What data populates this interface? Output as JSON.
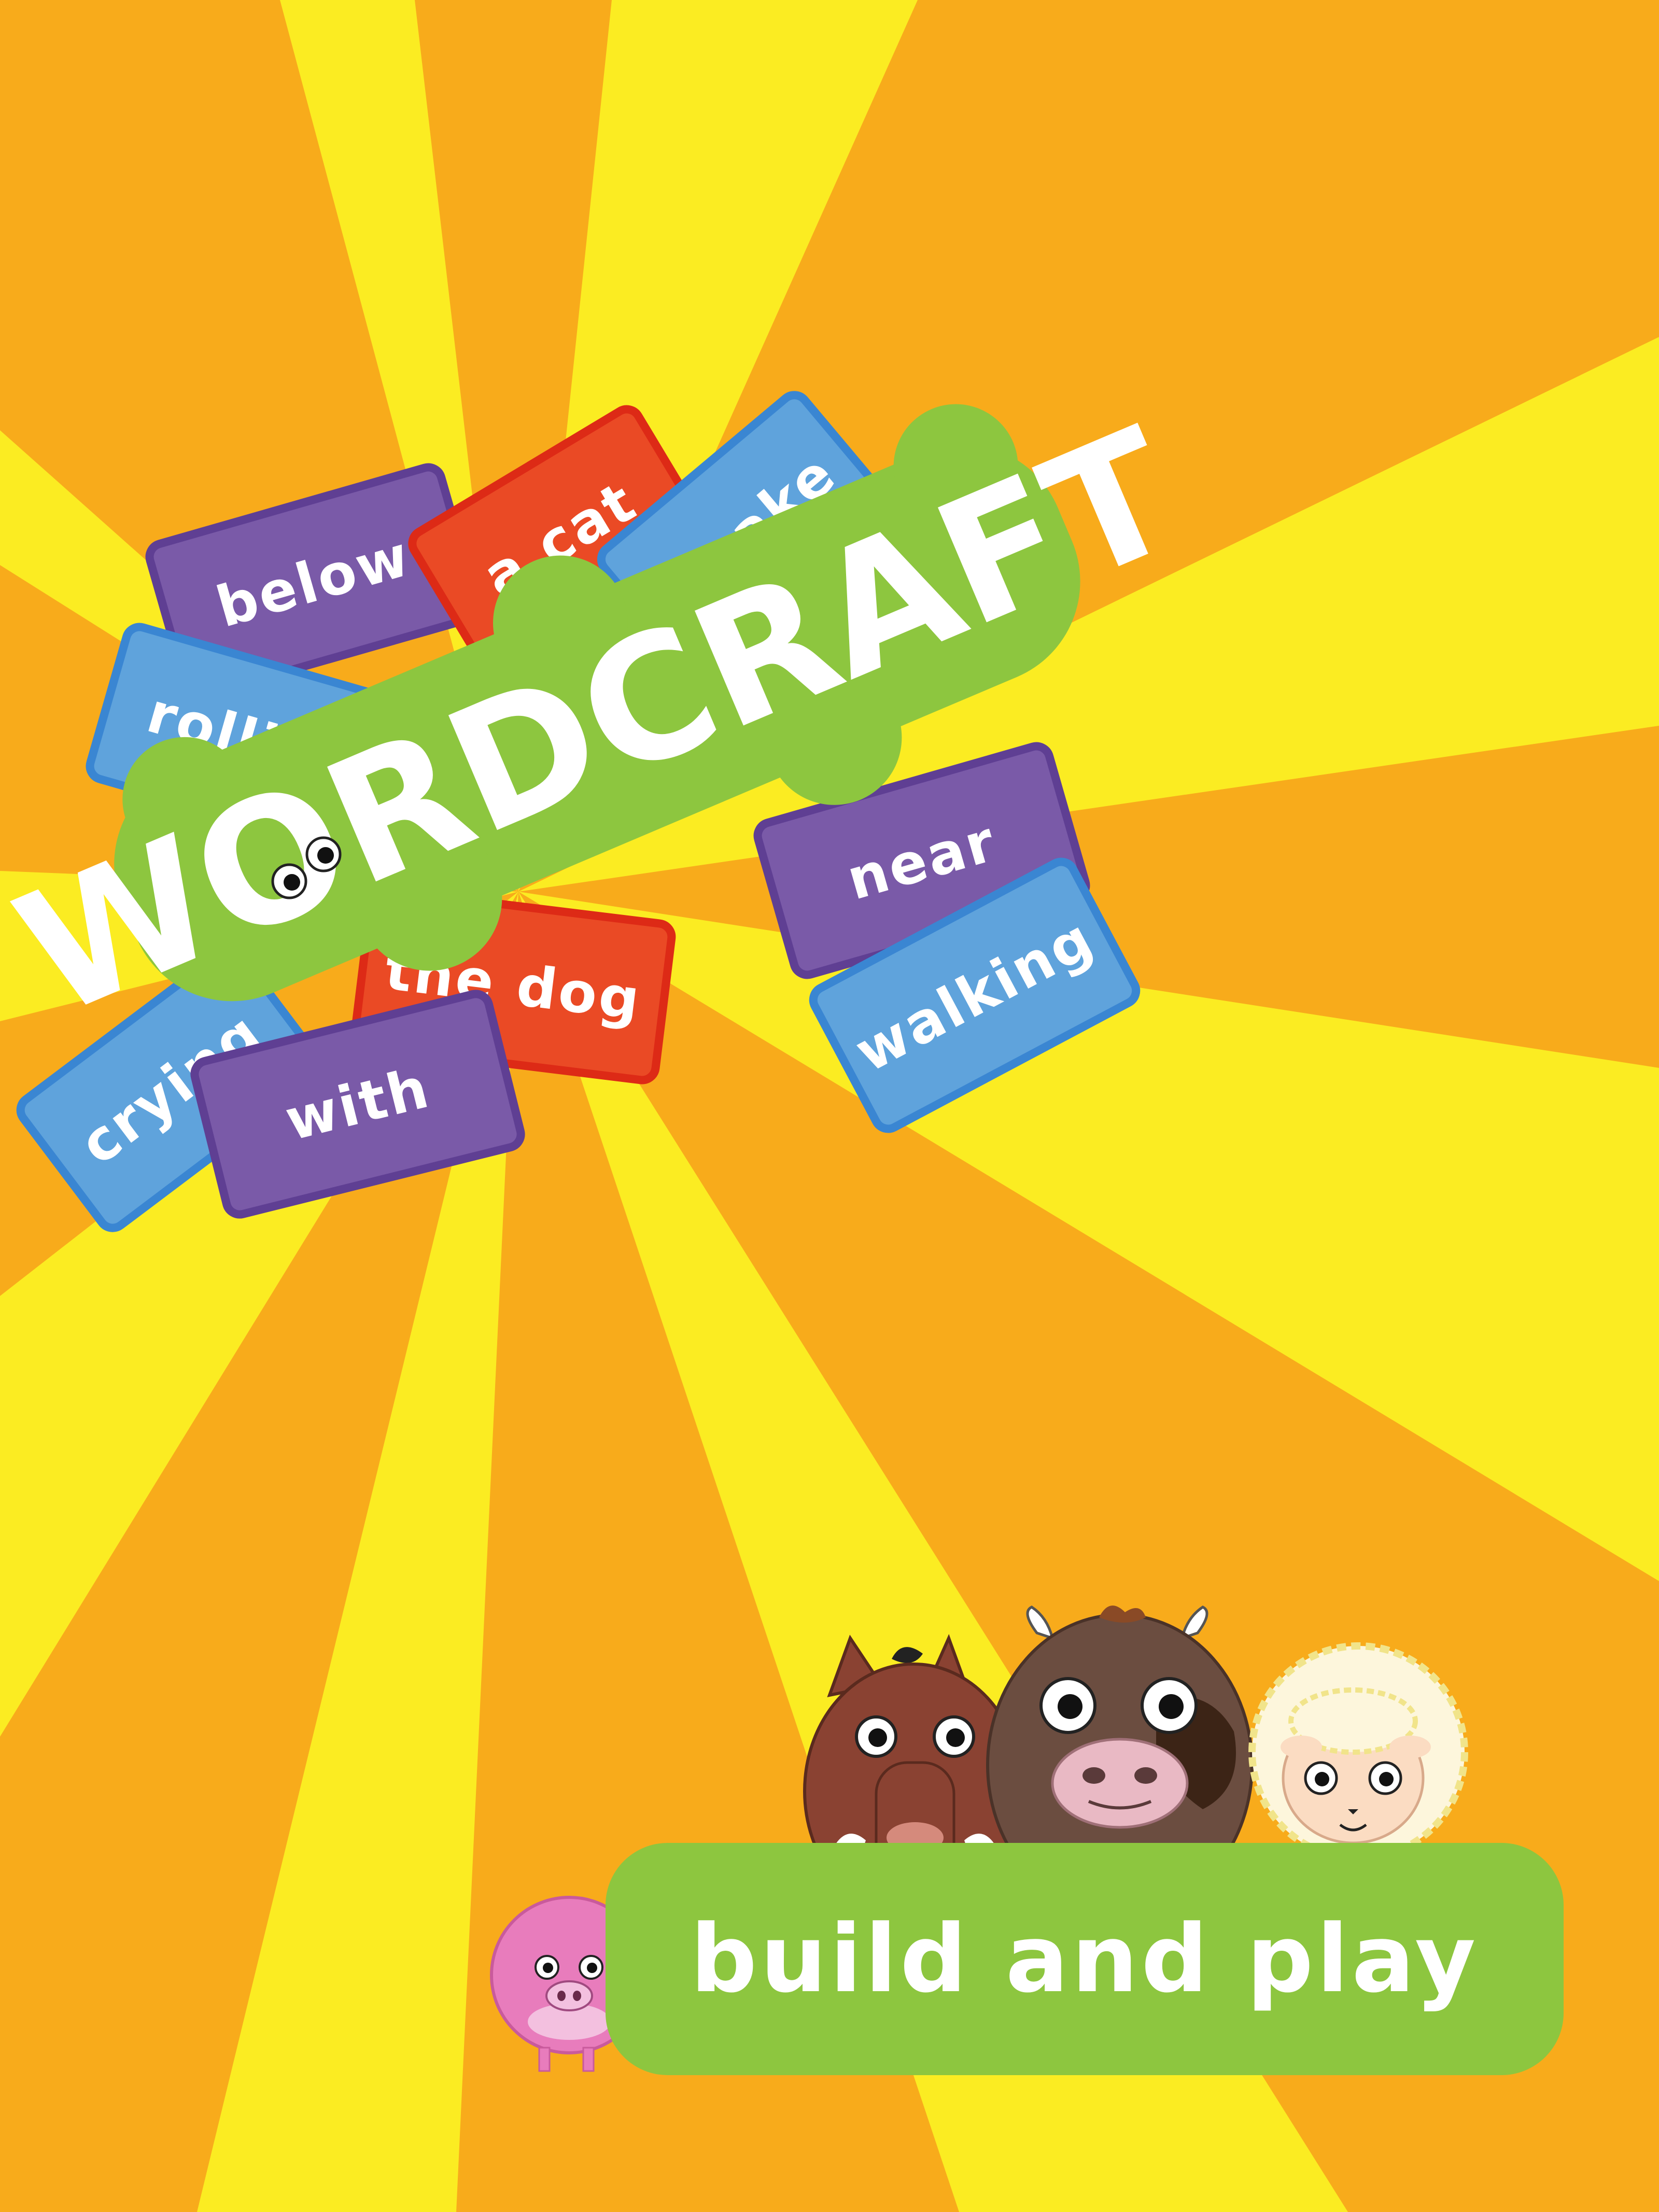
{
  "app": {
    "logo_text": "WORDCRAFT"
  },
  "word_tiles": [
    {
      "text": "below",
      "color": "purple"
    },
    {
      "text": "a cat",
      "color": "red"
    },
    {
      "text": "awake",
      "color": "blue"
    },
    {
      "text": "rolling",
      "color": "blue"
    },
    {
      "text": "near",
      "color": "purple"
    },
    {
      "text": "the dog",
      "color": "red"
    },
    {
      "text": "crying",
      "color": "blue"
    },
    {
      "text": "with",
      "color": "purple"
    },
    {
      "text": "walking",
      "color": "blue"
    }
  ],
  "characters": [
    "horse-icon",
    "cow-icon",
    "sheep-icon",
    "pig-icon"
  ],
  "cta": {
    "label": "build and play"
  },
  "colors": {
    "ray_yellow": "#fbec22",
    "ray_orange": "#f8ab1b",
    "logo_green": "#8dc63f",
    "tile_purple": "#7a5aa8",
    "tile_red": "#ea4a25",
    "tile_blue": "#5fa3dc"
  }
}
